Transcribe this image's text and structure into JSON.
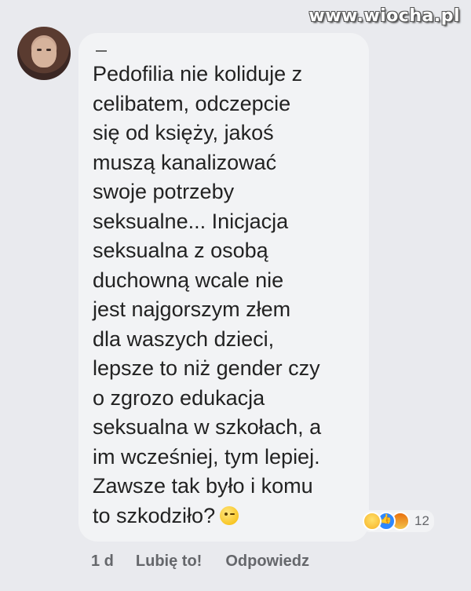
{
  "watermark": "www.wiocha.pl",
  "comment": {
    "text": "Pedofilia nie koliduje z\ncelibatem, odczepcie\nsię od księży, jakoś\nmuszą kanalizować\nswoje potrzeby\nseksualne...  Inicjacja\nseksualna z osobą\nduchowną wcale nie\njest najgorszym złem\ndla waszych dzieci,\nlepsze to niż gender czy\no zgrozo edukacja\nseksualna w szkołach, a\nim wcześniej, tym lepiej.\nZawsze tak było i komu\nto szkodziło?",
    "emoji": "wink-emoji"
  },
  "reactions": {
    "icons": [
      "haha-icon",
      "like-icon",
      "angry-icon"
    ],
    "count": "12"
  },
  "actions": {
    "time": "1 d",
    "like_label": "Lubię to!",
    "reply_label": "Odpowiedz"
  }
}
